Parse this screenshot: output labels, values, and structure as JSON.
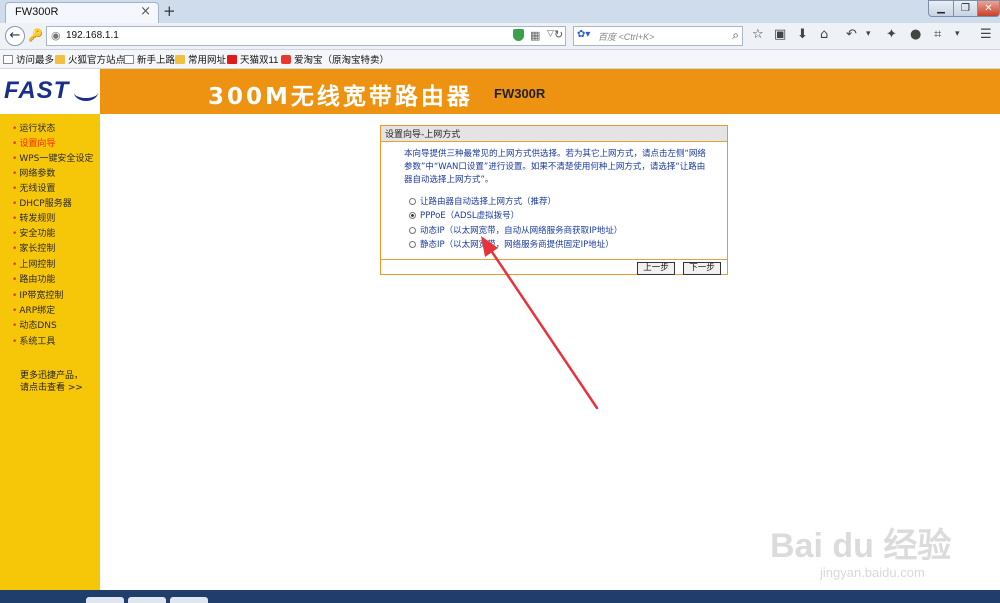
{
  "browser": {
    "tab_title": "FW300R",
    "tab_close": "×",
    "new_tab": "+",
    "url": "192.168.1.1",
    "search_placeholder": "百度 <Ctrl+K>",
    "window_controls": {
      "minimize": "▁",
      "maximize": "❐",
      "close": "✕"
    }
  },
  "bookmarks": [
    {
      "label": "访问最多",
      "icon": "bookmark-star-icon"
    },
    {
      "label": "火狐官方站点",
      "icon": "folder-icon"
    },
    {
      "label": "新手上路",
      "icon": "page-icon"
    },
    {
      "label": "常用网址",
      "icon": "folder-icon"
    },
    {
      "label": "天猫双11",
      "icon": "tmall-icon"
    },
    {
      "label": "爱淘宝（原淘宝特卖）",
      "icon": "taobao-icon"
    }
  ],
  "router": {
    "logo": "FAST",
    "title": "300M无线宽带路由器",
    "model": "FW300R"
  },
  "sidebar": {
    "items": [
      {
        "label": "运行状态",
        "active": false
      },
      {
        "label": "设置向导",
        "active": true
      },
      {
        "label": "WPS一键安全设定",
        "active": false
      },
      {
        "label": "网络参数",
        "active": false
      },
      {
        "label": "无线设置",
        "active": false
      },
      {
        "label": "DHCP服务器",
        "active": false
      },
      {
        "label": "转发规则",
        "active": false
      },
      {
        "label": "安全功能",
        "active": false
      },
      {
        "label": "家长控制",
        "active": false
      },
      {
        "label": "上网控制",
        "active": false
      },
      {
        "label": "路由功能",
        "active": false
      },
      {
        "label": "IP带宽控制",
        "active": false
      },
      {
        "label": "ARP绑定",
        "active": false
      },
      {
        "label": "动态DNS",
        "active": false
      },
      {
        "label": "系统工具",
        "active": false
      }
    ],
    "more_line1": "更多迅捷产品，",
    "more_line2": "请点击查看 >>"
  },
  "wizard": {
    "title": "设置向导-上网方式",
    "description": "本向导提供三种最常见的上网方式供选择。若为其它上网方式，请点击左侧“网络参数”中“WAN口设置”进行设置。如果不清楚使用何种上网方式，请选择“让路由器自动选择上网方式”。",
    "options": [
      {
        "label": "让路由器自动选择上网方式（推荐）",
        "checked": false
      },
      {
        "label": "PPPoE（ADSL虚拟拨号）",
        "checked": true
      },
      {
        "label": "动态IP（以太网宽带，自动从网络服务商获取IP地址）",
        "checked": false
      },
      {
        "label": "静态IP（以太网宽带，网络服务商提供固定IP地址）",
        "checked": false
      }
    ],
    "prev_button": "上一步",
    "next_button": "下一步"
  },
  "watermark": {
    "main": "Bai du 经验",
    "sub": "jingyan.baidu.com"
  },
  "colors": {
    "header_orange": "#ee9211",
    "sidebar_yellow": "#f6c609",
    "arrow_red": "#e8333a",
    "text_blue": "#1a3aa0"
  }
}
